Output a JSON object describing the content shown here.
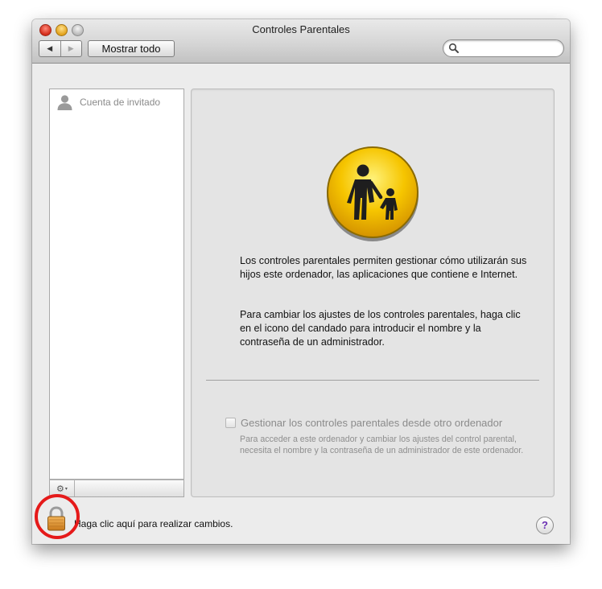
{
  "window": {
    "title": "Controles Parentales"
  },
  "toolbar": {
    "back_icon": "back-arrow-icon",
    "forward_icon": "forward-arrow-icon",
    "back_glyph": "◀",
    "forward_glyph": "▶",
    "show_all_label": "Mostrar todo",
    "search_value": ""
  },
  "sidebar": {
    "users": [
      {
        "name": "Cuenta de invitado",
        "icon": "user-silhouette-icon"
      }
    ],
    "action_icon": "gear-icon",
    "action_glyph": "⚙",
    "action_caret": "▾"
  },
  "main": {
    "icon": "parental-controls-icon",
    "paragraph_1": "Los controles parentales permiten gestionar cómo utilizarán sus hijos este ordenador, las aplicaciones que contiene e Internet.",
    "paragraph_2": "Para cambiar los ajustes de los controles parentales, haga clic en el icono del candado para introducir el nombre y la contraseña de un administrador.",
    "remote_checkbox_label": "Gestionar los controles parentales desde otro ordenador",
    "remote_checkbox_checked": false,
    "remote_description": "Para acceder a este ordenador y cambiar los ajustes del control parental, necesita el nombre y la contraseña de un administrador de este ordenador."
  },
  "footer": {
    "lock_icon": "padlock-icon",
    "lock_text": "Haga clic aquí para realizar cambios.",
    "help_label": "?"
  },
  "colors": {
    "annotation_circle": "#e51a1a",
    "parental_icon_yellow": "#f6c500",
    "help_purple": "#6a2fb3"
  }
}
